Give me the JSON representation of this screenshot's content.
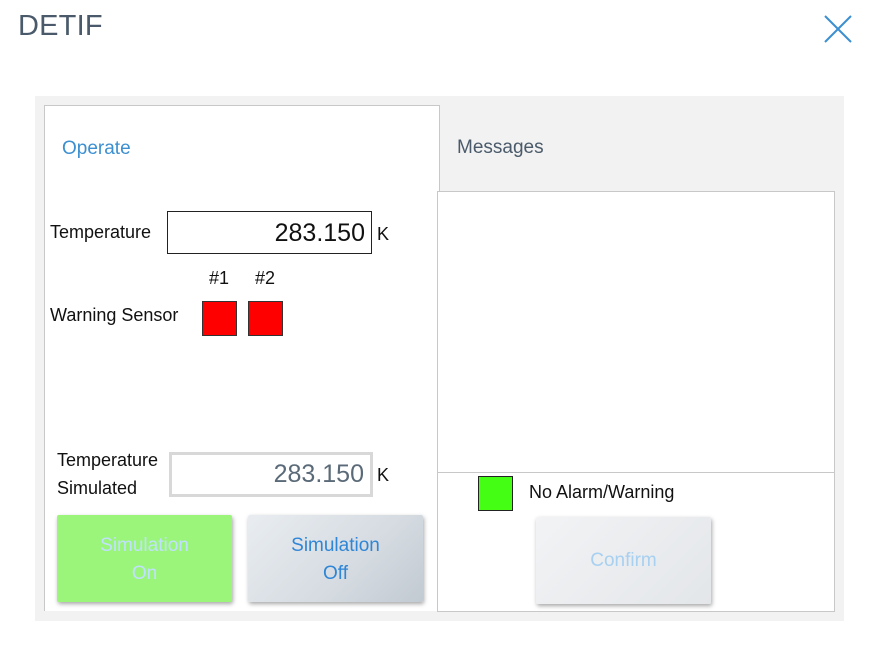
{
  "window": {
    "title": "DETIF"
  },
  "tabs": {
    "operate_label": "Operate",
    "messages_label": "Messages"
  },
  "operate": {
    "temperature_label": "Temperature",
    "temperature_value": "283.150",
    "temperature_unit": "K",
    "sensor_1_label": "#1",
    "sensor_2_label": "#2",
    "warning_sensor_label": "Warning Sensor",
    "temp_simulated_label_line1": "Temperature",
    "temp_simulated_label_line2": "Simulated",
    "temp_simulated_value": "283.150",
    "temp_simulated_unit": "K",
    "sim_on_line1": "Simulation",
    "sim_on_line2": "On",
    "sim_off_line1": "Simulation",
    "sim_off_line2": "Off"
  },
  "messages": {
    "status_text": "No Alarm/Warning",
    "confirm_label": "Confirm"
  },
  "colors": {
    "sensor_warning": "#ff0000",
    "no_alarm_indicator": "#44ff14",
    "sim_on_button": "#9bf57a",
    "accent": "#3c8fd0"
  },
  "icons": {
    "close": "close-icon"
  }
}
